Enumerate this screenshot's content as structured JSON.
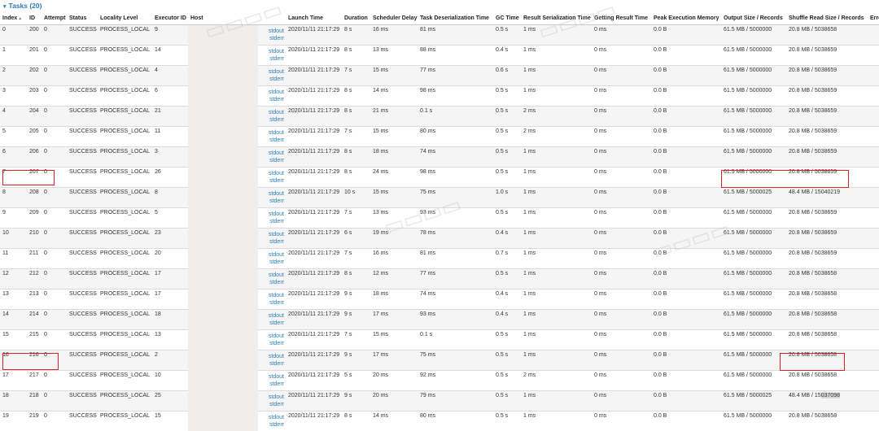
{
  "section": {
    "caret": "▾",
    "title": "Tasks (20)"
  },
  "columns": [
    "Index",
    "ID",
    "Attempt",
    "Status",
    "Locality Level",
    "Executor ID",
    "Host",
    "",
    "Launch Time",
    "Duration",
    "Scheduler Delay",
    "Task Deserialization Time",
    "GC Time",
    "Result Serialization Time",
    "Getting Result Time",
    "Peak Execution Memory",
    "Output Size / Records",
    "Shuffle Read Size / Records",
    "Erro"
  ],
  "sort_indicator": "▲",
  "log_links": {
    "stdout": "stdout",
    "stderr": "stderr"
  },
  "rows": [
    {
      "index": "0",
      "id": "200",
      "attempt": "0",
      "status": "SUCCESS",
      "locality": "PROCESS_LOCAL",
      "executor": "9",
      "launch": "2020/11/11 21:17:29",
      "duration": "8 s",
      "sched": "16 ms",
      "deser": "81 ms",
      "gc": "0.5 s",
      "resser": "1 ms",
      "getres": "0 ms",
      "peak": "0.0 B",
      "output": "61.5 MB / 5000000",
      "shuffle": "20.8 MB / 5038658"
    },
    {
      "index": "1",
      "id": "201",
      "attempt": "0",
      "status": "SUCCESS",
      "locality": "PROCESS_LOCAL",
      "executor": "14",
      "launch": "2020/11/11 21:17:29",
      "duration": "8 s",
      "sched": "13 ms",
      "deser": "88 ms",
      "gc": "0.4 s",
      "resser": "1 ms",
      "getres": "0 ms",
      "peak": "0.0 B",
      "output": "61.5 MB / 5000000",
      "shuffle": "20.8 MB / 5038659"
    },
    {
      "index": "2",
      "id": "202",
      "attempt": "0",
      "status": "SUCCESS",
      "locality": "PROCESS_LOCAL",
      "executor": "4",
      "launch": "2020/11/11 21:17:29",
      "duration": "7 s",
      "sched": "15 ms",
      "deser": "77 ms",
      "gc": "0.6 s",
      "resser": "1 ms",
      "getres": "0 ms",
      "peak": "0.0 B",
      "output": "61.5 MB / 5000000",
      "shuffle": "20.8 MB / 5038659"
    },
    {
      "index": "3",
      "id": "203",
      "attempt": "0",
      "status": "SUCCESS",
      "locality": "PROCESS_LOCAL",
      "executor": "6",
      "launch": "2020/11/11 21:17:29",
      "duration": "8 s",
      "sched": "14 ms",
      "deser": "98 ms",
      "gc": "0.5 s",
      "resser": "1 ms",
      "getres": "0 ms",
      "peak": "0.0 B",
      "output": "61.5 MB / 5000000",
      "shuffle": "20.8 MB / 5038659"
    },
    {
      "index": "4",
      "id": "204",
      "attempt": "0",
      "status": "SUCCESS",
      "locality": "PROCESS_LOCAL",
      "executor": "21",
      "launch": "2020/11/11 21:17:29",
      "duration": "8 s",
      "sched": "21 ms",
      "deser": "0.1 s",
      "gc": "0.5 s",
      "resser": "2 ms",
      "getres": "0 ms",
      "peak": "0.0 B",
      "output": "61.5 MB / 5000000",
      "shuffle": "20.8 MB / 5038659"
    },
    {
      "index": "5",
      "id": "205",
      "attempt": "0",
      "status": "SUCCESS",
      "locality": "PROCESS_LOCAL",
      "executor": "11",
      "launch": "2020/11/11 21:17:29",
      "duration": "7 s",
      "sched": "15 ms",
      "deser": "80 ms",
      "gc": "0.5 s",
      "resser": "2 ms",
      "getres": "0 ms",
      "peak": "0.0 B",
      "output": "61.5 MB / 5000000",
      "shuffle": "20.8 MB / 5038659"
    },
    {
      "index": "6",
      "id": "206",
      "attempt": "0",
      "status": "SUCCESS",
      "locality": "PROCESS_LOCAL",
      "executor": "3",
      "launch": "2020/11/11 21:17:29",
      "duration": "8 s",
      "sched": "18 ms",
      "deser": "74 ms",
      "gc": "0.5 s",
      "resser": "1 ms",
      "getres": "0 ms",
      "peak": "0.0 B",
      "output": "61.5 MB / 5000000",
      "shuffle": "20.8 MB / 5038659"
    },
    {
      "index": "7",
      "id": "207",
      "attempt": "0",
      "status": "SUCCESS",
      "locality": "PROCESS_LOCAL",
      "executor": "26",
      "launch": "2020/11/11 21:17:29",
      "duration": "8 s",
      "sched": "24 ms",
      "deser": "98 ms",
      "gc": "0.5 s",
      "resser": "1 ms",
      "getres": "0 ms",
      "peak": "0.0 B",
      "output": "61.5 MB / 5000000",
      "shuffle": "20.8 MB / 5038659"
    },
    {
      "index": "8",
      "id": "208",
      "attempt": "0",
      "status": "SUCCESS",
      "locality": "PROCESS_LOCAL",
      "executor": "8",
      "launch": "2020/11/11 21:17:29",
      "duration": "10 s",
      "sched": "15 ms",
      "deser": "75 ms",
      "gc": "1.0 s",
      "resser": "1 ms",
      "getres": "0 ms",
      "peak": "0.0 B",
      "output": "61.5 MB / 5000025",
      "shuffle": "48.4 MB / 15040219"
    },
    {
      "index": "9",
      "id": "209",
      "attempt": "0",
      "status": "SUCCESS",
      "locality": "PROCESS_LOCAL",
      "executor": "5",
      "launch": "2020/11/11 21:17:29",
      "duration": "7 s",
      "sched": "13 ms",
      "deser": "93 ms",
      "gc": "0.5 s",
      "resser": "1 ms",
      "getres": "0 ms",
      "peak": "0.0 B",
      "output": "61.5 MB / 5000000",
      "shuffle": "20.8 MB / 5038659"
    },
    {
      "index": "10",
      "id": "210",
      "attempt": "0",
      "status": "SUCCESS",
      "locality": "PROCESS_LOCAL",
      "executor": "23",
      "launch": "2020/11/11 21:17:29",
      "duration": "6 s",
      "sched": "19 ms",
      "deser": "78 ms",
      "gc": "0.4 s",
      "resser": "1 ms",
      "getres": "0 ms",
      "peak": "0.0 B",
      "output": "61.5 MB / 5000000",
      "shuffle": "20.8 MB / 5038659"
    },
    {
      "index": "11",
      "id": "211",
      "attempt": "0",
      "status": "SUCCESS",
      "locality": "PROCESS_LOCAL",
      "executor": "20",
      "launch": "2020/11/11 21:17:29",
      "duration": "7 s",
      "sched": "16 ms",
      "deser": "81 ms",
      "gc": "0.7 s",
      "resser": "1 ms",
      "getres": "0 ms",
      "peak": "0.0 B",
      "output": "61.5 MB / 5000000",
      "shuffle": "20.8 MB / 5038659"
    },
    {
      "index": "12",
      "id": "212",
      "attempt": "0",
      "status": "SUCCESS",
      "locality": "PROCESS_LOCAL",
      "executor": "17",
      "launch": "2020/11/11 21:17:29",
      "duration": "8 s",
      "sched": "12 ms",
      "deser": "77 ms",
      "gc": "0.5 s",
      "resser": "1 ms",
      "getres": "0 ms",
      "peak": "0.0 B",
      "output": "61.5 MB / 5000000",
      "shuffle": "20.8 MB / 5038658"
    },
    {
      "index": "13",
      "id": "213",
      "attempt": "0",
      "status": "SUCCESS",
      "locality": "PROCESS_LOCAL",
      "executor": "17",
      "launch": "2020/11/11 21:17:29",
      "duration": "9 s",
      "sched": "18 ms",
      "deser": "74 ms",
      "gc": "0.4 s",
      "resser": "1 ms",
      "getres": "0 ms",
      "peak": "0.0 B",
      "output": "61.5 MB / 5000000",
      "shuffle": "20.8 MB / 5038658"
    },
    {
      "index": "14",
      "id": "214",
      "attempt": "0",
      "status": "SUCCESS",
      "locality": "PROCESS_LOCAL",
      "executor": "18",
      "launch": "2020/11/11 21:17:29",
      "duration": "9 s",
      "sched": "17 ms",
      "deser": "93 ms",
      "gc": "0.4 s",
      "resser": "1 ms",
      "getres": "0 ms",
      "peak": "0.0 B",
      "output": "61.5 MB / 5000000",
      "shuffle": "20.8 MB / 5038658"
    },
    {
      "index": "15",
      "id": "215",
      "attempt": "0",
      "status": "SUCCESS",
      "locality": "PROCESS_LOCAL",
      "executor": "13",
      "launch": "2020/11/11 21:17:29",
      "duration": "7 s",
      "sched": "15 ms",
      "deser": "0.1 s",
      "gc": "0.5 s",
      "resser": "1 ms",
      "getres": "0 ms",
      "peak": "0.0 B",
      "output": "61.5 MB / 5000000",
      "shuffle": "20.8 MB / 5038658"
    },
    {
      "index": "16",
      "id": "216",
      "attempt": "0",
      "status": "SUCCESS",
      "locality": "PROCESS_LOCAL",
      "executor": "2",
      "launch": "2020/11/11 21:17:29",
      "duration": "9 s",
      "sched": "17 ms",
      "deser": "75 ms",
      "gc": "0.5 s",
      "resser": "1 ms",
      "getres": "0 ms",
      "peak": "0.0 B",
      "output": "61.5 MB / 5000000",
      "shuffle": "20.8 MB / 5038658"
    },
    {
      "index": "17",
      "id": "217",
      "attempt": "0",
      "status": "SUCCESS",
      "locality": "PROCESS_LOCAL",
      "executor": "10",
      "launch": "2020/11/11 21:17:29",
      "duration": "5 s",
      "sched": "20 ms",
      "deser": "92 ms",
      "gc": "0.5 s",
      "resser": "2 ms",
      "getres": "0 ms",
      "peak": "0.0 B",
      "output": "61.5 MB / 5000000",
      "shuffle": "20.8 MB / 5038658"
    },
    {
      "index": "18",
      "id": "218",
      "attempt": "0",
      "status": "SUCCESS",
      "locality": "PROCESS_LOCAL",
      "executor": "25",
      "launch": "2020/11/11 21:17:29",
      "duration": "9 s",
      "sched": "20 ms",
      "deser": "79 ms",
      "gc": "0.5 s",
      "resser": "1 ms",
      "getres": "0 ms",
      "peak": "0.0 B",
      "output": "61.5 MB / 5000025",
      "shuffle_prefix": "48.4 MB / 15",
      "shuffle_highlight": "037098"
    },
    {
      "index": "19",
      "id": "219",
      "attempt": "0",
      "status": "SUCCESS",
      "locality": "PROCESS_LOCAL",
      "executor": "15",
      "launch": "2020/11/11 21:17:29",
      "duration": "8 s",
      "sched": "14 ms",
      "deser": "80 ms",
      "gc": "0.5 s",
      "resser": "1 ms",
      "getres": "0 ms",
      "peak": "0.0 B",
      "output": "61.5 MB / 5000000",
      "shuffle": "20.8 MB / 5038658"
    }
  ]
}
